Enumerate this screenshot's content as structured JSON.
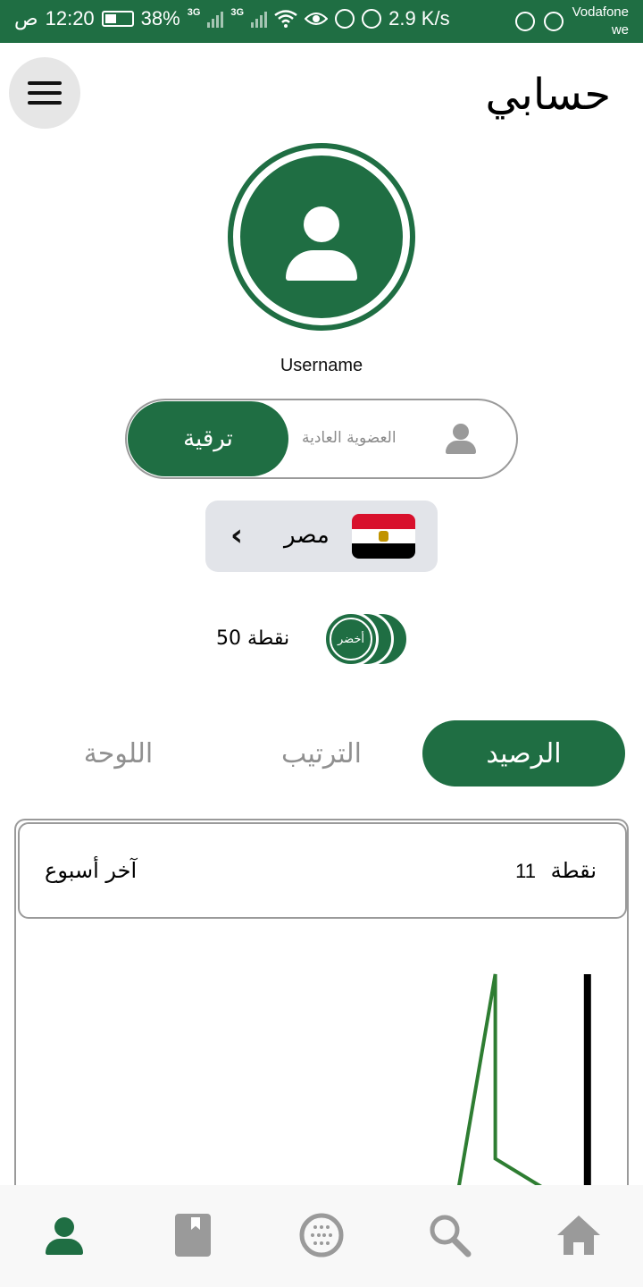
{
  "status_bar": {
    "time": "12:20",
    "am_pm": "ص",
    "battery": "38%",
    "net1": "3G",
    "net2": "3G",
    "speed": "2.9 K/s",
    "carrier_line1": "Vodafone",
    "carrier_line2": "we"
  },
  "header": {
    "title": "حسابي",
    "menu_icon": "hamburger-menu-icon"
  },
  "profile": {
    "avatar_icon": "person-icon",
    "username": "Username"
  },
  "membership": {
    "upgrade_label": "ترقية",
    "level_label": "العضوية العادية",
    "icon": "person-icon"
  },
  "country": {
    "name": "مصر",
    "flag": "egypt-flag",
    "chevron": "‹"
  },
  "points": {
    "text": "50 نقطة",
    "badge_label": "أخضر"
  },
  "tabs": [
    {
      "label": "الرصيد",
      "active": true
    },
    {
      "label": "الترتيب",
      "active": false
    },
    {
      "label": "اللوحة",
      "active": false
    }
  ],
  "summary": {
    "points_label": "نقطة",
    "points_value": "11",
    "period_label": "آخر أسبوع"
  },
  "chart_data": {
    "type": "line",
    "title": "",
    "xlabel": "",
    "ylabel": "",
    "grid": false,
    "series": [
      {
        "color": "#2e7d32",
        "points": [
          [
            0.72,
            0.0
          ],
          [
            0.78,
            1.0
          ],
          [
            0.78,
            0.14
          ],
          [
            0.86,
            0.0
          ]
        ]
      },
      {
        "color": "#000000",
        "points": [
          [
            0.93,
            0.0
          ],
          [
            0.93,
            1.0
          ]
        ]
      }
    ]
  },
  "bottom_nav": [
    {
      "icon": "profile-icon",
      "active": true
    },
    {
      "icon": "book-icon",
      "active": false
    },
    {
      "icon": "globe-icon",
      "active": false
    },
    {
      "icon": "search-icon",
      "active": false
    },
    {
      "icon": "home-icon",
      "active": false
    }
  ],
  "colors": {
    "primary": "#1f6e43",
    "inactive": "#9a9a9a",
    "country_bg": "#e2e4e9"
  }
}
